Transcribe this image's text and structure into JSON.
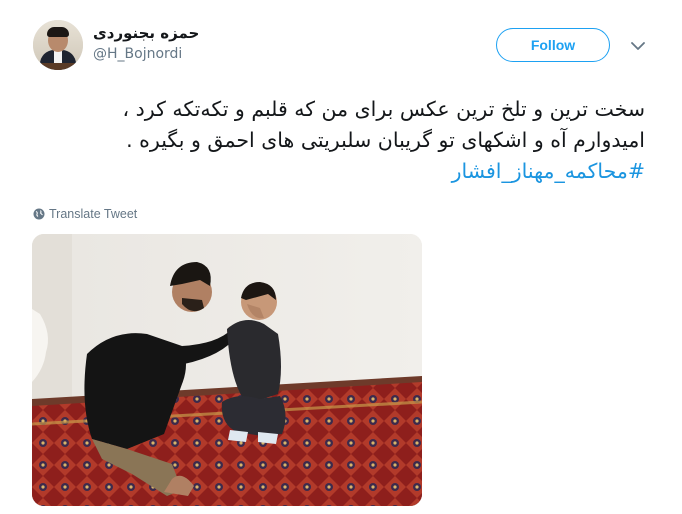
{
  "author": {
    "display_name": "حمزه بجنوردی",
    "handle": "@H_Bojnordi",
    "avatar_icon": "profile-photo"
  },
  "actions": {
    "follow_label": "Follow",
    "more_icon": "chevron-down-icon"
  },
  "tweet": {
    "lines": [
      "سخت ترین و تلخ ترین عکس برای من که قلبم و تکه‌تکه کرد ،",
      "امیدوارم آه و اشکهای تو گریبان سلبریتی های احمق و بگیره ."
    ],
    "hashtag": "#محاکمه_مهناز_افشار"
  },
  "translate_label": "Translate Tweet",
  "colors": {
    "accent": "#1da1f2",
    "hashtag": "#1b95e0",
    "muted": "#657786",
    "text": "#14171a"
  },
  "media": {
    "icon": "tweet-photo"
  }
}
